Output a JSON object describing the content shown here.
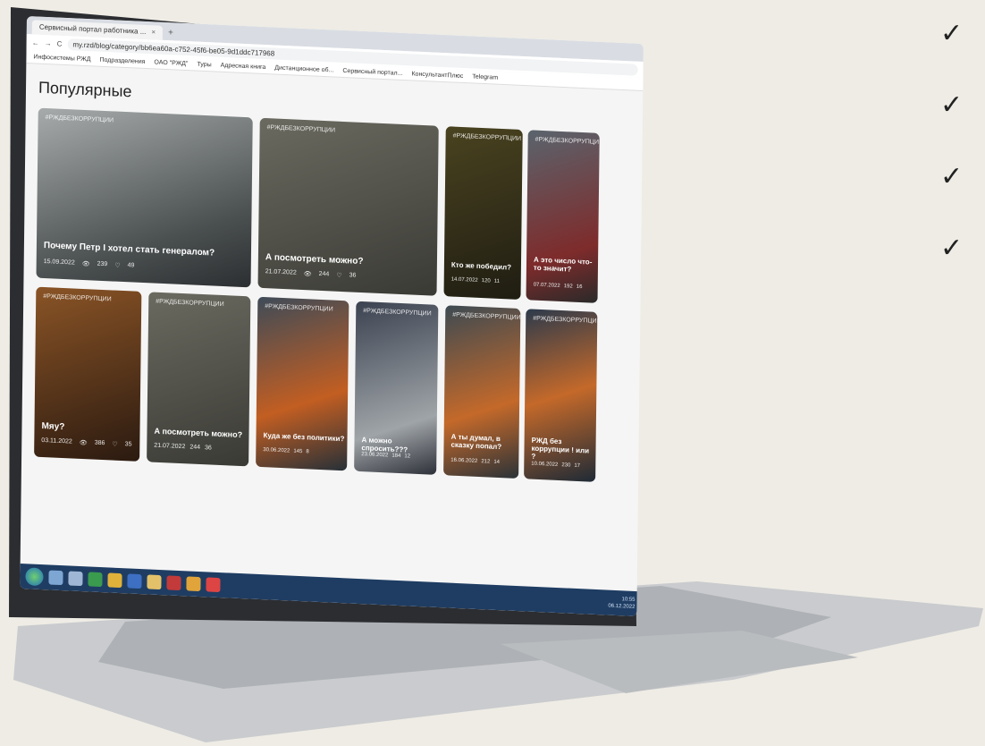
{
  "browser": {
    "tab_title": "Сервисный портал работника ...",
    "tab_close": "×",
    "new_tab": "+",
    "nav_back": "←",
    "nav_forward": "→",
    "nav_reload": "C",
    "url": "my.rzd/blog/category/bb6ea60a-c752-45f6-be05-9d1ddc717968",
    "bookmarks": [
      "Инфосистемы РЖД",
      "Подразделения",
      "ОАО \"РЖД\"",
      "Туры",
      "Адресная книга",
      "Дистанционное об...",
      "Сервисный портал...",
      "КонсультантПлюс",
      "Telegram"
    ]
  },
  "page": {
    "title": "Популярные"
  },
  "cards": [
    {
      "tag": "#РЖДБЕЗКОРРУПЦИИ",
      "title": "Почему Петр I хотел стать генералом?",
      "date": "15.09.2022",
      "views": "239",
      "likes": "49"
    },
    {
      "tag": "#РЖДБЕЗКОРРУПЦИИ",
      "title": "А посмотреть можно?",
      "date": "21.07.2022",
      "views": "244",
      "likes": "36"
    },
    {
      "tag": "#РЖДБЕЗКОРРУПЦИИ",
      "title": "Кто же победил?",
      "date": "14.07.2022",
      "views": "120",
      "likes": "11"
    },
    {
      "tag": "#РЖДБЕЗКОРРУПЦИИ",
      "title": "А это число что-то значит?",
      "date": "07.07.2022",
      "views": "192",
      "likes": "16"
    },
    {
      "tag": "#РЖДБЕЗКОРРУПЦИИ",
      "title": "Мяу?",
      "date": "03.11.2022",
      "views": "386",
      "likes": "35"
    },
    {
      "tag": "#РЖДБЕЗКОРРУПЦИИ",
      "title": "А посмотреть можно?",
      "date": "21.07.2022",
      "views": "244",
      "likes": "36"
    },
    {
      "tag": "#РЖДБЕЗКОРРУПЦИИ",
      "title": "Куда же без политики?",
      "date": "30.06.2022",
      "views": "145",
      "likes": "8"
    },
    {
      "tag": "#РЖДБЕЗКОРРУПЦИИ",
      "title": "А можно спросить???",
      "date": "23.06.2022",
      "views": "184",
      "likes": "12"
    },
    {
      "tag": "#РЖДБЕЗКОРРУПЦИИ",
      "title": "А ты думал, в сказку попал?",
      "date": "16.06.2022",
      "views": "212",
      "likes": "14"
    },
    {
      "tag": "#РЖДБЕЗКОРРУПЦИИ",
      "title": "РЖД без коррупции ! или ?",
      "date": "10.06.2022",
      "views": "230",
      "likes": "17"
    }
  ],
  "icons": {
    "views": "👁",
    "likes": "♡",
    "check": "✓"
  },
  "checks": [
    "✓",
    "✓",
    "✓",
    "✓"
  ],
  "taskbar": {
    "time": "10:55",
    "date": "06.12.2022"
  }
}
